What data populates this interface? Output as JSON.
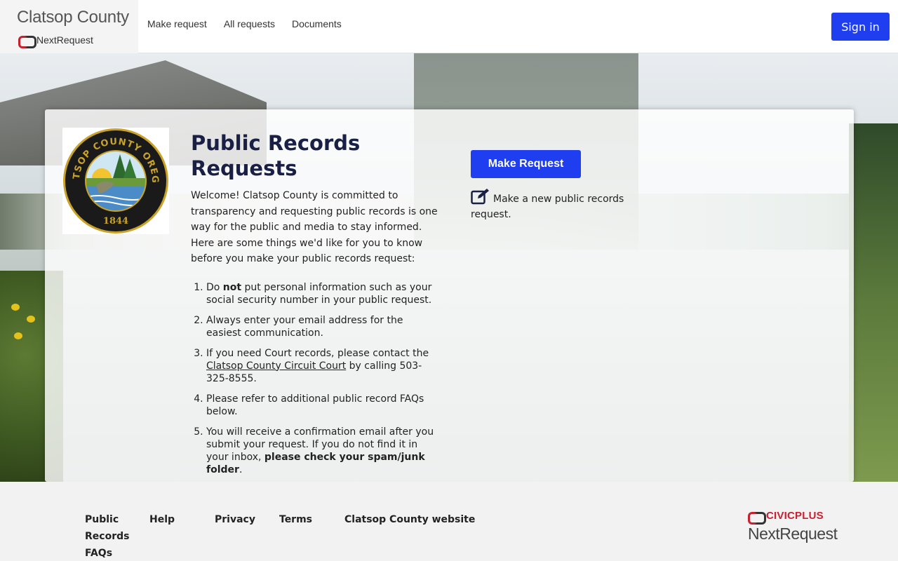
{
  "header": {
    "brand_name": "Clatsop County",
    "brand_sub": "NextRequest",
    "nav": [
      "Make request",
      "All requests",
      "Documents"
    ],
    "sign_in": "Sign in"
  },
  "main": {
    "seal": {
      "top_text": "CLATSOP COUNTY OREGON",
      "year": "1844"
    },
    "title": "Public Records Requests",
    "welcome": "Welcome! Clatsop County is committed to transparency and requesting public records is one way for the public and media to stay informed. Here are some things we'd like for you to know before you make your public records request:",
    "faq": {
      "item1_pre": "Do ",
      "item1_bold": "not",
      "item1_post": " put personal information such as your social security number in your public request.",
      "item2": "Always enter your email address for the easiest communication.",
      "item3_pre": "If you need Court records, please contact the ",
      "item3_link": "Clatsop County Circuit Court",
      "item3_post": " by calling 503-325-8555.",
      "item4": "Please refer to additional public record FAQs below.",
      "item5_pre": "You will receive a confirmation email after you submit your request. If you do not find it in your inbox, ",
      "item5_bold": "please check your spam/junk folder",
      "item5_post": "."
    },
    "make_request_button": "Make Request",
    "make_request_desc": "Make a new public records request.",
    "icons": {
      "edit": "edit-icon"
    }
  },
  "footer": {
    "links": [
      "Public Records FAQs",
      "Help",
      "Privacy",
      "Terms",
      "Clatsop County website"
    ],
    "brand_top": "CIVICPLUS",
    "brand_bottom": "NextRequest"
  },
  "colors": {
    "primary": "#1f3ef0",
    "title": "#1a1f45",
    "brand_red": "#c8202f"
  }
}
